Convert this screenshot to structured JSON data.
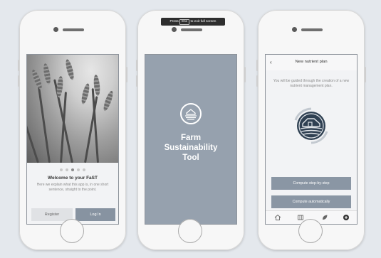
{
  "fullscreen_banner": {
    "prefix": "Press",
    "key": "Esc",
    "suffix": "to exit full screen"
  },
  "onboarding": {
    "pagination_count": 5,
    "pagination_active": 3,
    "title": "Welcome to your FaST",
    "body": "Here we explain what this app is, in one short sentence, straight to the point.",
    "register_label": "Register",
    "login_label": "Log In"
  },
  "splash": {
    "app_name_line1": "Farm",
    "app_name_line2": "Sustainability",
    "app_name_line3": "Tool",
    "logo_icon": "farm-logo-icon"
  },
  "nutrient_plan": {
    "title": "New nutrient plan",
    "back_icon": "chevron-left-icon",
    "description": "You will be guided through the creation of a new nutrient management plan.",
    "illustration_icon": "farm-illustration-icon",
    "step_button": "Compute step-by-step",
    "auto_button": "Compute automatically",
    "tabbar_icons": [
      "home-icon",
      "map-icon",
      "leaf-icon",
      "add-icon"
    ]
  },
  "colors": {
    "background": "#e4e8ed",
    "accent": "#8a96a4",
    "splash": "#96a1ae"
  }
}
